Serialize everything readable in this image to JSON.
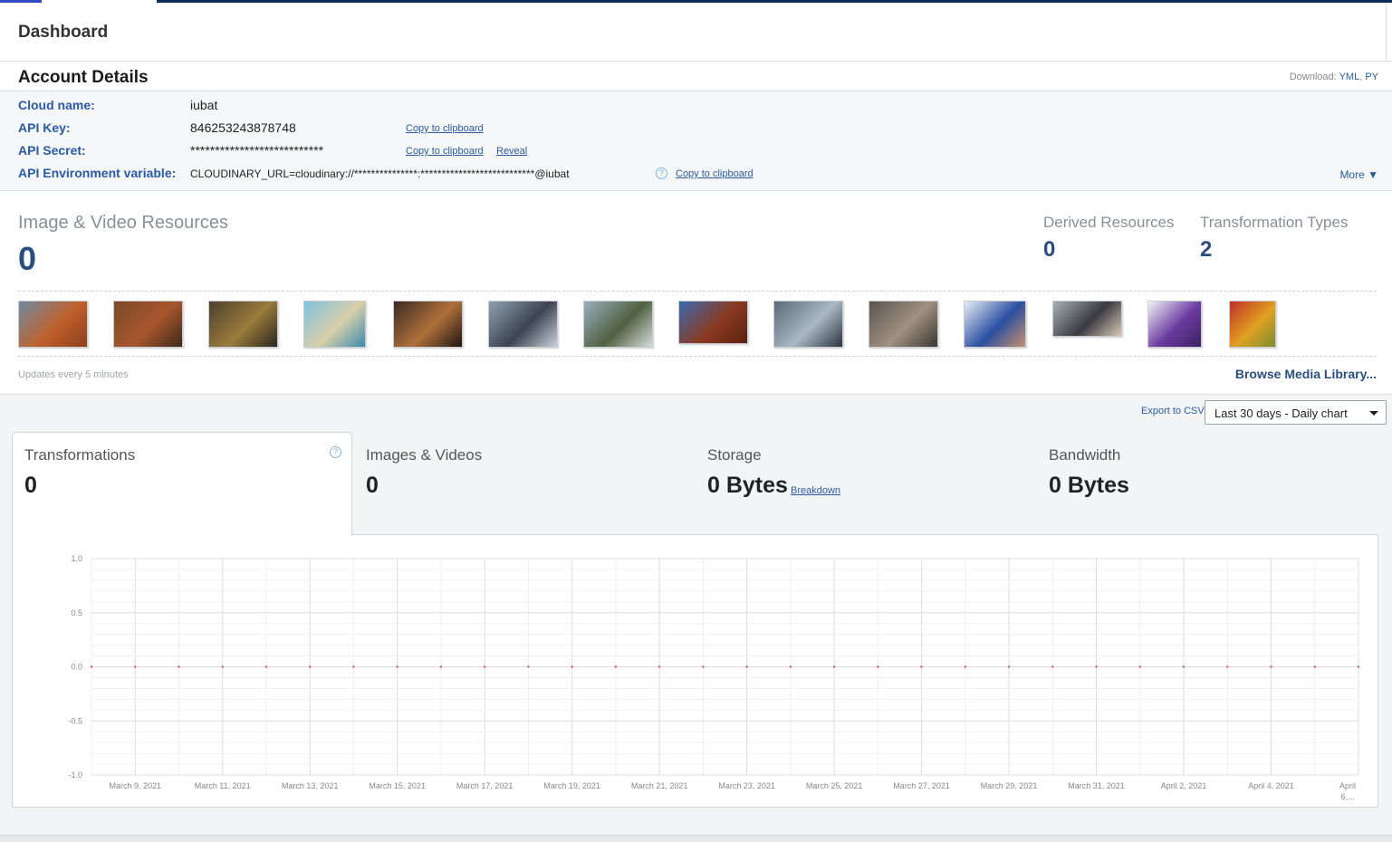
{
  "page": {
    "title": "Dashboard"
  },
  "account": {
    "title": "Account Details",
    "download_label": "Download:",
    "download_yml": "YML",
    "download_sep": ",",
    "download_py": "PY",
    "cloud_name_label": "Cloud name:",
    "cloud_name": "iubat",
    "api_key_label": "API Key:",
    "api_key": "846253243878748",
    "api_secret_label": "API Secret:",
    "api_secret": "***************************",
    "env_label": "API Environment variable:",
    "env_value": "CLOUDINARY_URL=cloudinary://***************:***************************@iubat",
    "copy_label": "Copy to clipboard",
    "reveal_label": "Reveal",
    "help_glyph": "?",
    "more_label": "More ▼"
  },
  "resources": {
    "main_label": "Image & Video Resources",
    "main_count": "0",
    "derived_label": "Derived Resources",
    "derived_count": "0",
    "types_label": "Transformation Types",
    "types_count": "2",
    "updates_note": "Updates every 5 minutes",
    "browse_label": "Browse Media Library...",
    "thumbnails": [
      {
        "name": "bag",
        "colors": [
          "#6f8aa0",
          "#c0612d",
          "#8c3e1c"
        ]
      },
      {
        "name": "woman-autumn",
        "colors": [
          "#7a4a2a",
          "#a8562c",
          "#3d2a1a"
        ]
      },
      {
        "name": "street-men",
        "colors": [
          "#4d4030",
          "#9a7b3a",
          "#2c2620"
        ]
      },
      {
        "name": "beach",
        "colors": [
          "#7fc3e0",
          "#d8cfa8",
          "#3a8ab0"
        ]
      },
      {
        "name": "dogs",
        "colors": [
          "#3a2a22",
          "#b0703a",
          "#1c1612"
        ]
      },
      {
        "name": "street-sign",
        "colors": [
          "#8fa0b0",
          "#3c4450",
          "#c8d2dc"
        ]
      },
      {
        "name": "mountain-valley",
        "colors": [
          "#9ab0c0",
          "#506040",
          "#d8dcdc"
        ]
      },
      {
        "name": "runner",
        "colors": [
          "#3a6ab0",
          "#8a3a20",
          "#5a2010"
        ]
      },
      {
        "name": "group-photo",
        "colors": [
          "#5a6a7a",
          "#aab8c4",
          "#2a3440"
        ]
      },
      {
        "name": "flatlay",
        "colors": [
          "#5a5550",
          "#a09080",
          "#3a3632"
        ]
      },
      {
        "name": "child-snow",
        "colors": [
          "#e8eef6",
          "#2a50a0",
          "#c89070"
        ]
      },
      {
        "name": "crowd-panorama",
        "colors": [
          "#a8b0b8",
          "#3a3a40",
          "#d8c8b8"
        ]
      },
      {
        "name": "sneakers",
        "colors": [
          "#f4f4f6",
          "#6a3aa0",
          "#3a2060"
        ]
      },
      {
        "name": "spices",
        "colors": [
          "#c0302a",
          "#e0a020",
          "#7a9030"
        ]
      }
    ]
  },
  "stats": {
    "export_label": "Export to CSV",
    "range_select": "Last 30 days - Daily chart",
    "tabs": [
      {
        "label": "Transformations",
        "value": "0"
      },
      {
        "label": "Images & Videos",
        "value": "0"
      },
      {
        "label": "Storage",
        "value": "0 Bytes"
      },
      {
        "label": "Bandwidth",
        "value": "0 Bytes"
      }
    ],
    "breakdown_label": "Breakdown",
    "help_glyph": "?"
  },
  "chart_data": {
    "type": "scatter",
    "ylim": [
      -1.0,
      1.0
    ],
    "y_ticks": [
      "1.0",
      "0.5",
      "0.0",
      "-0.5",
      "-1.0"
    ],
    "x_tick_labels": [
      "March 9, 2021",
      "March 11, 2021",
      "March 13, 2021",
      "March 15, 2021",
      "March 17, 2021",
      "March 19, 2021",
      "March 21, 2021",
      "March 23, 2021",
      "March 25, 2021",
      "March 27, 2021",
      "March 29, 2021",
      "March 31, 2021",
      "April 2, 2021",
      "April 4, 2021"
    ],
    "last_tick_label": [
      "April",
      "6,..."
    ],
    "x": [
      "2021-03-08",
      "2021-03-09",
      "2021-03-10",
      "2021-03-11",
      "2021-03-12",
      "2021-03-13",
      "2021-03-14",
      "2021-03-15",
      "2021-03-16",
      "2021-03-17",
      "2021-03-18",
      "2021-03-19",
      "2021-03-20",
      "2021-03-21",
      "2021-03-22",
      "2021-03-23",
      "2021-03-24",
      "2021-03-25",
      "2021-03-26",
      "2021-03-27",
      "2021-03-28",
      "2021-03-29",
      "2021-03-30",
      "2021-03-31",
      "2021-04-01",
      "2021-04-02",
      "2021-04-03",
      "2021-04-04",
      "2021-04-05",
      "2021-04-06"
    ],
    "series": [
      {
        "values": [
          0,
          0,
          0,
          0,
          0,
          0,
          0,
          0,
          0,
          0,
          0,
          0,
          0,
          0,
          0,
          0,
          0,
          0,
          0,
          0,
          0,
          0,
          0,
          0,
          0,
          0,
          0,
          0,
          0,
          0
        ]
      }
    ],
    "grid": true,
    "point_color": "#e05060"
  }
}
